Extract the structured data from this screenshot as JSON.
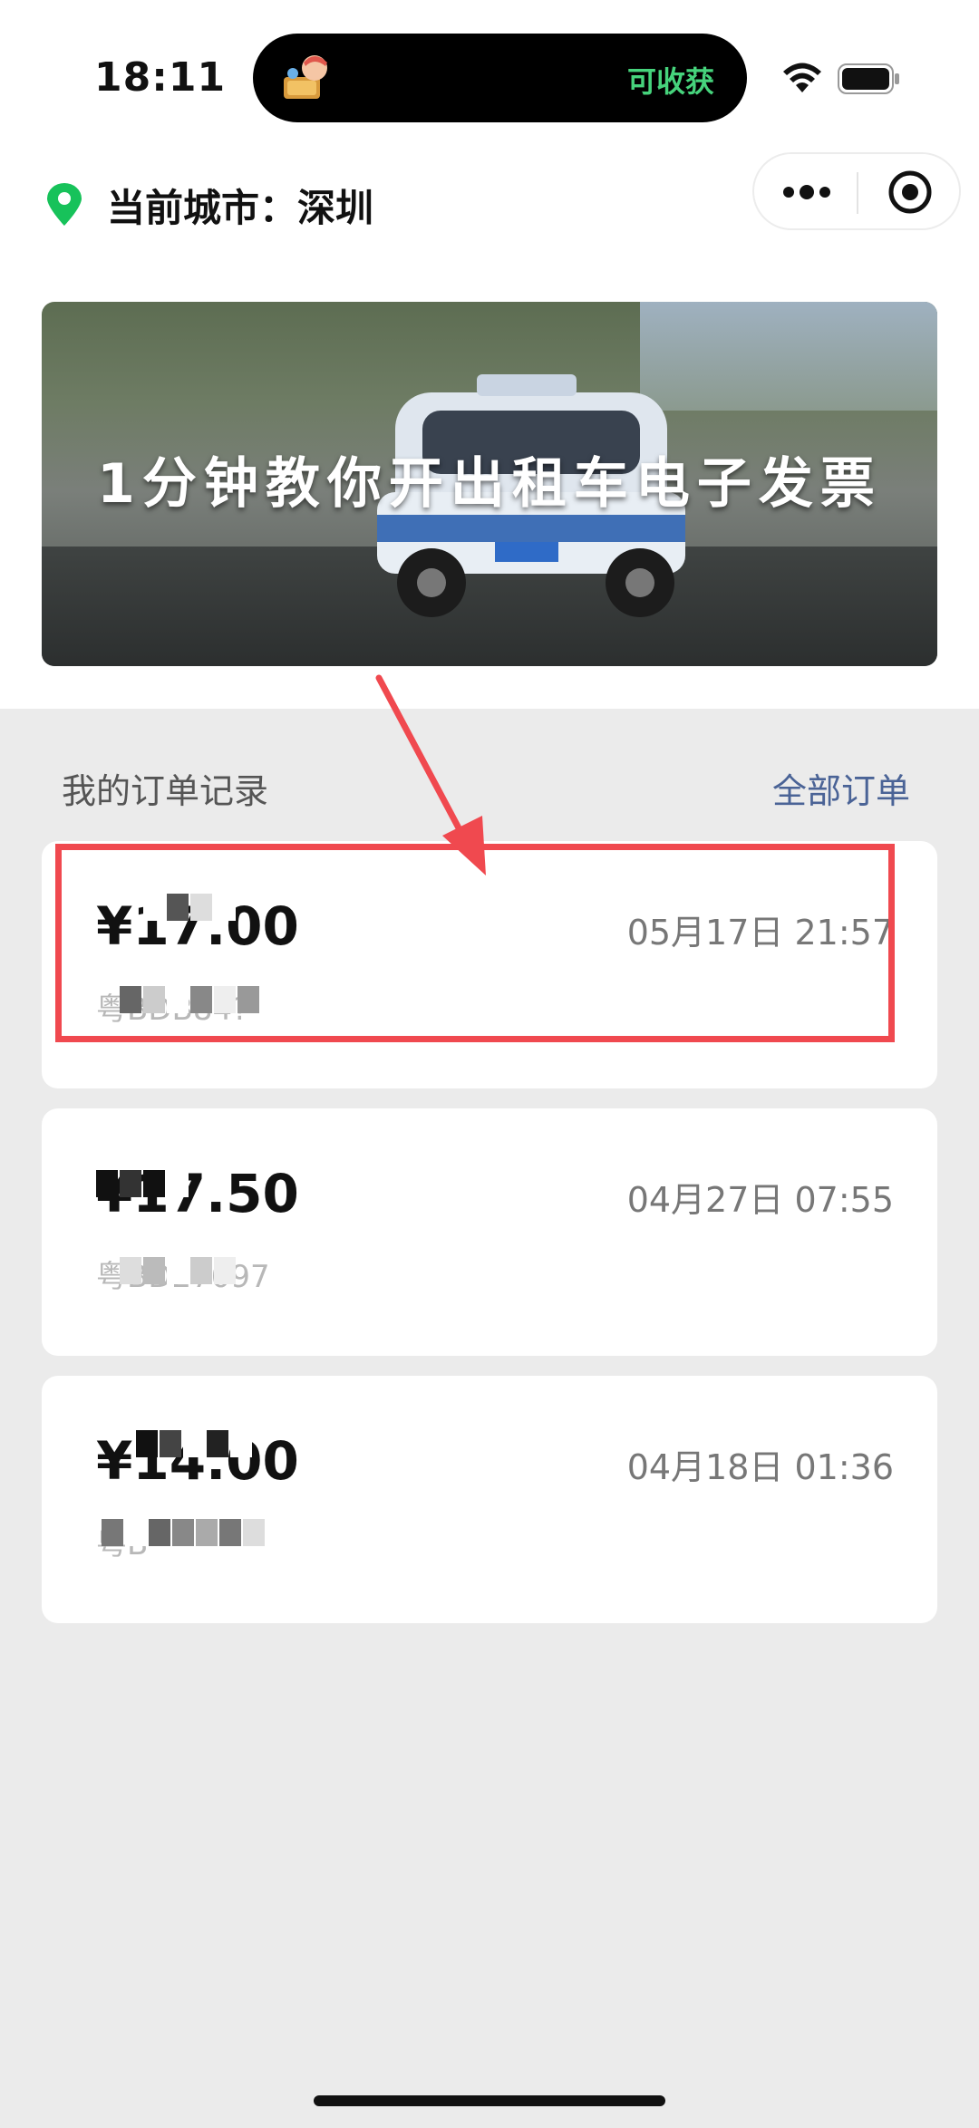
{
  "status_bar": {
    "time": "18:11",
    "island_text": "可收获"
  },
  "header": {
    "city_label": "当前城市：深圳"
  },
  "banner": {
    "title": "1分钟教你开出租车电子发票"
  },
  "orders": {
    "section_title": "我的订单记录",
    "all_orders_label": "全部订单",
    "items": [
      {
        "amount": "¥17.00",
        "date": "05月17日 21:57",
        "plate": "粤BDB84?"
      },
      {
        "amount": "¥17.50",
        "date": "04月27日 07:55",
        "plate": "粤BD27097"
      },
      {
        "amount": "¥14.00",
        "date": "04月18日 01:36",
        "plate": "粤B"
      }
    ]
  },
  "colors": {
    "accent": "#4a6396",
    "highlight": "#f0494f",
    "island_text": "#46d37c"
  }
}
